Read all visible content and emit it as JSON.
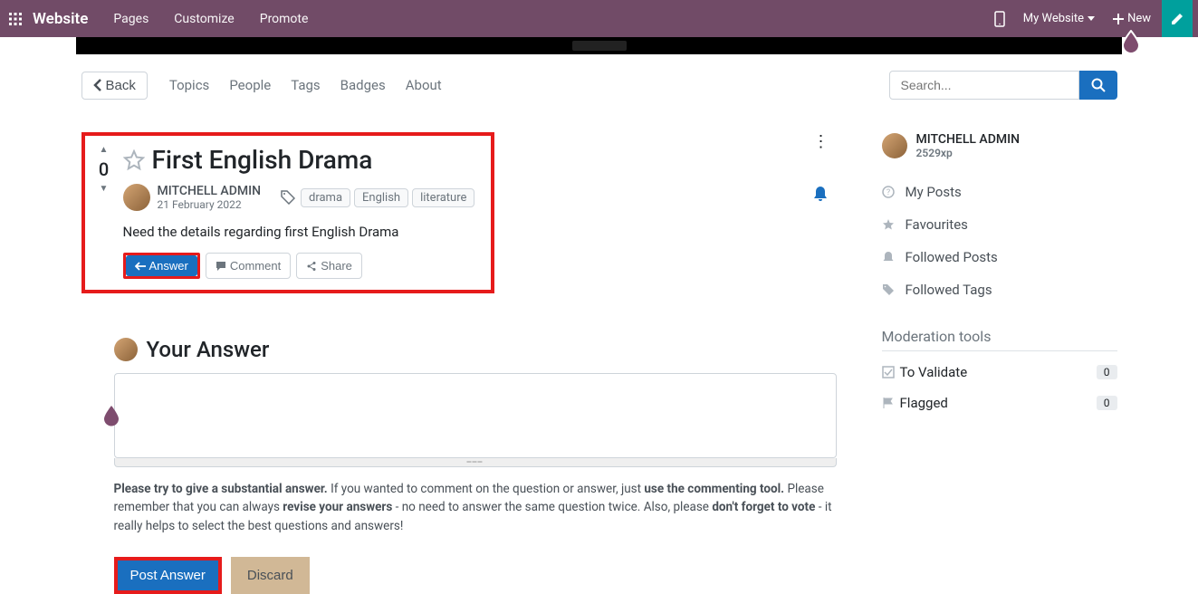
{
  "topbar": {
    "brand": "Website",
    "menu": [
      "Pages",
      "Customize",
      "Promote"
    ],
    "my_website": "My Website",
    "new_label": "New"
  },
  "subnav": {
    "back": "Back",
    "links": [
      "Topics",
      "People",
      "Tags",
      "Badges",
      "About"
    ],
    "search_placeholder": "Search..."
  },
  "question": {
    "score": "0",
    "title": "First English Drama",
    "author": "MITCHELL ADMIN",
    "date": "21 February 2022",
    "tags": [
      "drama",
      "English",
      "literature"
    ],
    "body": "Need the details regarding first English Drama",
    "actions": {
      "answer": "Answer",
      "comment": "Comment",
      "share": "Share"
    }
  },
  "answer_section": {
    "heading": "Your Answer",
    "hint_strong1": "Please try to give a substantial answer.",
    "hint_mid1": " If you wanted to comment on the question or answer, just ",
    "hint_strong2": "use the commenting tool.",
    "hint_mid2": " Please remember that you can always ",
    "hint_strong3": "revise your answers",
    "hint_mid3": " - no need to answer the same question twice. Also, please ",
    "hint_strong4": "don't forget to vote",
    "hint_mid4": " - it really helps to select the best questions and answers!",
    "post": "Post Answer",
    "discard": "Discard"
  },
  "sidebar": {
    "profile_name": "MITCHELL ADMIN",
    "profile_xp": "2529xp",
    "links": [
      "My Posts",
      "Favourites",
      "Followed Posts",
      "Followed Tags"
    ],
    "mod_title": "Moderation tools",
    "mod": [
      {
        "label": "To Validate",
        "count": "0"
      },
      {
        "label": "Flagged",
        "count": "0"
      }
    ]
  }
}
